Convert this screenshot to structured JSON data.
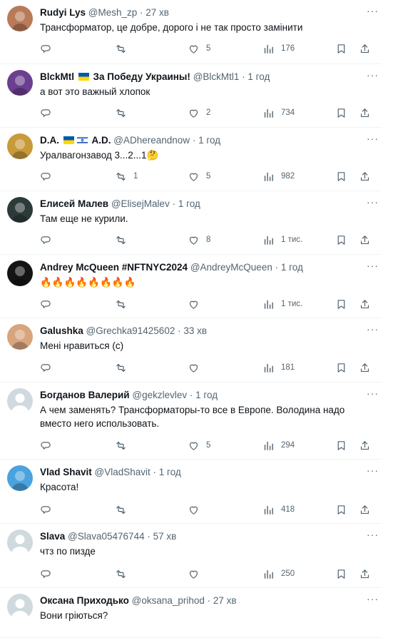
{
  "replies": [
    {
      "name": "Rudyi Lys",
      "flag": "",
      "handle": "@Mesh_zp",
      "time": "27 хв",
      "text": "Трансформатор, це добре, дорого і не так просто замінити",
      "reply": "",
      "retweet": "",
      "like": "5",
      "views": "176",
      "avatar_color": "#b97a57"
    },
    {
      "name": "BlckMtl",
      "flag": "ua",
      "name_suffix": "За Победу Украины!",
      "handle": "@BlckMtl1",
      "time": "1 год",
      "text": "а вот это важный хлопок",
      "reply": "",
      "retweet": "",
      "like": "2",
      "views": "734",
      "avatar_color": "#6b3f8f"
    },
    {
      "name": "D.A.",
      "flag": "ua-il",
      "name_suffix": "A.D.",
      "handle": "@ADhereandnow",
      "time": "1 год",
      "text": "Уралвагонзавод 3...2...1🤔",
      "reply": "",
      "retweet": "1",
      "like": "5",
      "views": "982",
      "avatar_color": "#c79a3a"
    },
    {
      "name": "Елисей Малев",
      "flag": "",
      "handle": "@ElisejMalev",
      "time": "1 год",
      "text": "Там еще не курили.",
      "reply": "",
      "retweet": "",
      "like": "8",
      "views": "1 тис.",
      "avatar_color": "#2c3b3a"
    },
    {
      "name": "Andrey McQueen #NFTNYC2024",
      "flag": "",
      "handle": "@AndreyMcQueen",
      "time": "1 год",
      "text": "🔥🔥🔥🔥🔥🔥🔥🔥",
      "reply": "",
      "retweet": "",
      "like": "",
      "views": "1 тис.",
      "avatar_color": "#141414"
    },
    {
      "name": "Galushka",
      "flag": "",
      "handle": "@Grechka91425602",
      "time": "33 хв",
      "text": "Мені нравиться (с)",
      "reply": "",
      "retweet": "",
      "like": "",
      "views": "181",
      "avatar_color": "#d8a47e"
    },
    {
      "name": "Богданов Валерий",
      "flag": "",
      "handle": "@gekzlevlev",
      "time": "1 год",
      "text": "А чем заменять? Трансформаторы-то все в Европе. Володина надо вместо него использовать.",
      "reply": "",
      "retweet": "",
      "like": "5",
      "views": "294",
      "avatar_color": "#cfd9de"
    },
    {
      "name": "Vlad Shavit",
      "flag": "",
      "handle": "@VladShavit",
      "time": "1 год",
      "text": "Красота!",
      "reply": "",
      "retweet": "",
      "like": "",
      "views": "418",
      "avatar_color": "#4aa3df"
    },
    {
      "name": "Slava",
      "flag": "",
      "handle": "@Slava05476744",
      "time": "57 хв",
      "text": "чтз по пизде",
      "reply": "",
      "retweet": "",
      "like": "",
      "views": "250",
      "avatar_color": "#cfd9de"
    },
    {
      "name": "Оксана Приходько",
      "flag": "",
      "handle": "@oksana_prihod",
      "time": "27 хв",
      "text": "Вони гріються?",
      "reply": "",
      "retweet": "",
      "like": "",
      "views": "",
      "avatar_color": "#cfd9de"
    }
  ],
  "more_label": "···",
  "icons": {
    "reply": "reply-icon",
    "retweet": "retweet-icon",
    "like": "heart-icon",
    "views": "views-icon",
    "bookmark": "bookmark-icon",
    "share": "share-icon"
  },
  "colors": {
    "text": "#0f1419",
    "muted": "#536471",
    "border": "#eff3f4"
  }
}
